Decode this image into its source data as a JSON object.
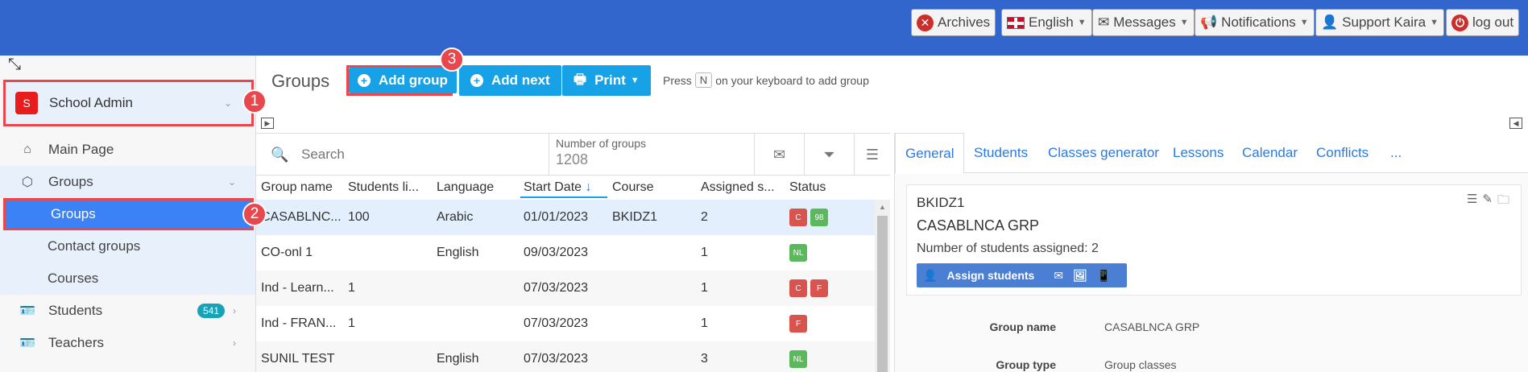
{
  "topbar": {
    "archives": "Archives",
    "language": "English",
    "messages": "Messages",
    "notifications": "Notifications",
    "user": "Support Kaira",
    "logout": "log out"
  },
  "sidebar": {
    "org_avatar": "S",
    "org_name": "School Admin",
    "items": [
      {
        "label": "Main Page",
        "icon": "home-icon"
      },
      {
        "label": "Groups",
        "icon": "cube-icon"
      },
      {
        "label": "Groups"
      },
      {
        "label": "Contact groups"
      },
      {
        "label": "Courses"
      },
      {
        "label": "Students",
        "icon": "id-card-icon",
        "badge": "541"
      },
      {
        "label": "Teachers",
        "icon": "id-card-icon"
      }
    ]
  },
  "callouts": [
    "1",
    "2",
    "3"
  ],
  "main": {
    "title": "Groups",
    "add_group": "Add group",
    "add_next": "Add next",
    "print": "Print",
    "hint_press": "Press",
    "hint_key": "N",
    "hint_rest": "on your keyboard to add group"
  },
  "table": {
    "search_placeholder": "Search",
    "count_label": "Number of groups",
    "count_value": "1208",
    "columns": [
      "Group name",
      "Students li...",
      "Language",
      "Start Date",
      "Course",
      "Assigned s...",
      "Status"
    ],
    "rows": [
      {
        "name": "CASABLNC...",
        "limit": "100",
        "language": "Arabic",
        "start": "01/01/2023",
        "course": "BKIDZ1",
        "assigned": "2",
        "status": [
          {
            "t": "C",
            "c": "red"
          },
          {
            "t": "98",
            "c": "green"
          }
        ]
      },
      {
        "name": "CO-onl 1",
        "limit": "",
        "language": "English",
        "start": "09/03/2023",
        "course": "",
        "assigned": "1",
        "status": [
          {
            "t": "NL",
            "c": "green"
          }
        ]
      },
      {
        "name": "Ind - Learn...",
        "limit": "1",
        "language": "",
        "start": "07/03/2023",
        "course": "",
        "assigned": "1",
        "status": [
          {
            "t": "C",
            "c": "red"
          },
          {
            "t": "F",
            "c": "red"
          }
        ]
      },
      {
        "name": "Ind - FRAN...",
        "limit": "1",
        "language": "",
        "start": "07/03/2023",
        "course": "",
        "assigned": "1",
        "status": [
          {
            "t": "F",
            "c": "red"
          }
        ]
      },
      {
        "name": "SUNIL TEST",
        "limit": "",
        "language": "English",
        "start": "07/03/2023",
        "course": "",
        "assigned": "3",
        "status": [
          {
            "t": "NL",
            "c": "green"
          }
        ]
      }
    ]
  },
  "detail": {
    "tabs": [
      "General",
      "Students",
      "Classes generator",
      "Lessons",
      "Calendar",
      "Conflicts",
      "..."
    ],
    "code": "BKIDZ1",
    "name": "CASABLNCA GRP",
    "assigned_text": "Number of students assigned: 2",
    "assign_btn": "Assign students",
    "fields": [
      {
        "label": "Group name",
        "value": "CASABLNCA GRP"
      },
      {
        "label": "Group type",
        "value": "Group classes"
      }
    ]
  },
  "colors": {
    "topbar": "#3366cc",
    "primary_button": "#17a2e8",
    "highlight_border": "#e8474e",
    "status_red": "#d9534f",
    "status_green": "#5cb85c"
  }
}
